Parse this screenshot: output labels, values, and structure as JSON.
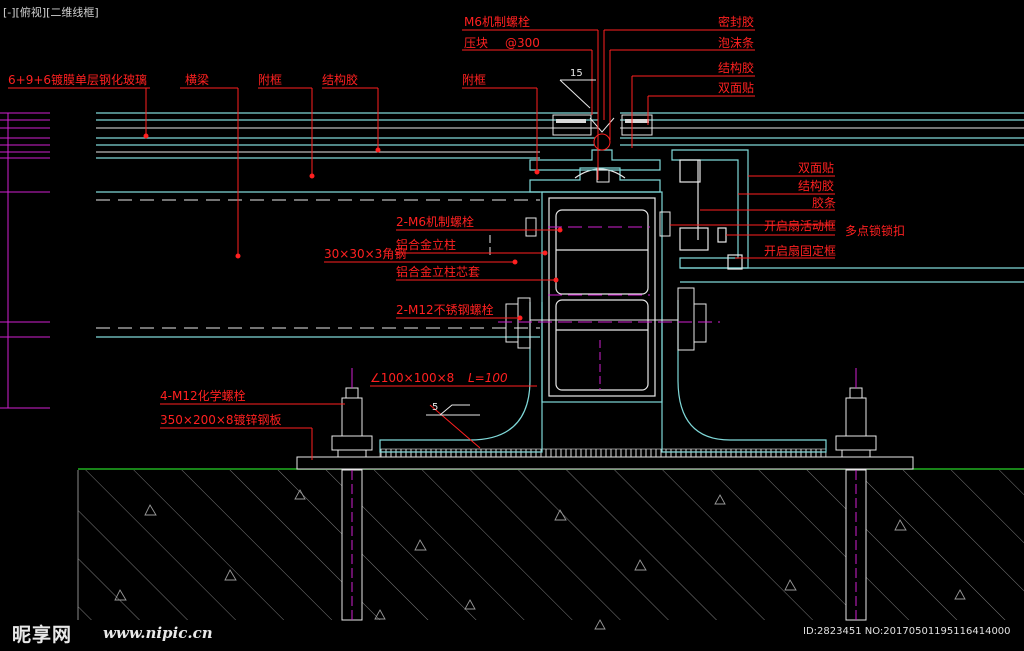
{
  "viewport_label": "[-][俯视][二维线框]",
  "watermark": {
    "logo": "昵享网",
    "url": "www.nipic.cn",
    "image_id": "ID:2823451 NO:20170501195116414000"
  },
  "colors": {
    "background": "#000000",
    "callout": "#ff2020",
    "outline": "#e8e8e8",
    "glass": "#7fd8d8",
    "dimension": "#d020d0",
    "ground": "#20b020",
    "concrete": "#909090"
  },
  "labels": {
    "m6_bolt": "M6机制螺栓",
    "pressure_block": "压块",
    "spacing": "@300",
    "sealant": "密封胶",
    "foam_strip": "泡沫条",
    "structural_glue_top": "结构胶",
    "double_tape_top": "双面贴",
    "glass": "6+9+6镀膜单层钢化玻璃",
    "purlin": "横梁",
    "sub_frame_left": "附框",
    "structural_glue_left": "结构胶",
    "sub_frame_mid": "附框",
    "slope_dim": "15",
    "double_tape_right": "双面贴",
    "structural_glue_right": "结构胶",
    "rubber_strip": "胶条",
    "vent_frame": "开启扇活动框",
    "multi_lock": "多点锁锁扣",
    "fixed_frame": "开启扇固定框",
    "m6_bolts_2": "2-M6机制螺栓",
    "alu_mullion": "铝合金立柱",
    "angle_30": "30×30×3角钢",
    "mullion_core": "铝合金立柱芯套",
    "m12_bolts": "2-M12不锈钢螺栓",
    "angle_100": "∠100×100×8",
    "length": "L=100",
    "chem_anchor": "4-M12化学螺栓",
    "steel_plate": "350×200×8镀锌钢板",
    "weld": "5"
  }
}
